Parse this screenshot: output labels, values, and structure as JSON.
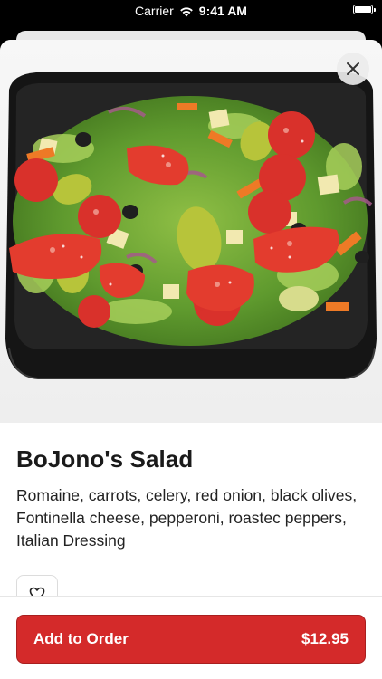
{
  "status_bar": {
    "carrier": "Carrier",
    "time": "9:41 AM",
    "icons": [
      "wifi-icon",
      "battery-icon"
    ]
  },
  "item": {
    "title": "BoJono's Salad",
    "description": "Romaine, carrots, celery, red onion, black olives, Fontinella cheese, pepperoni, roastec peppers, Italian Dressing",
    "image_alt": "salad-photo"
  },
  "icons": {
    "close": "close-icon",
    "favorite": "heart-icon"
  },
  "order_button": {
    "label": "Add to Order",
    "price": "$12.95"
  },
  "colors": {
    "accent": "#d42a2a",
    "accent_border": "#a81f1f"
  }
}
